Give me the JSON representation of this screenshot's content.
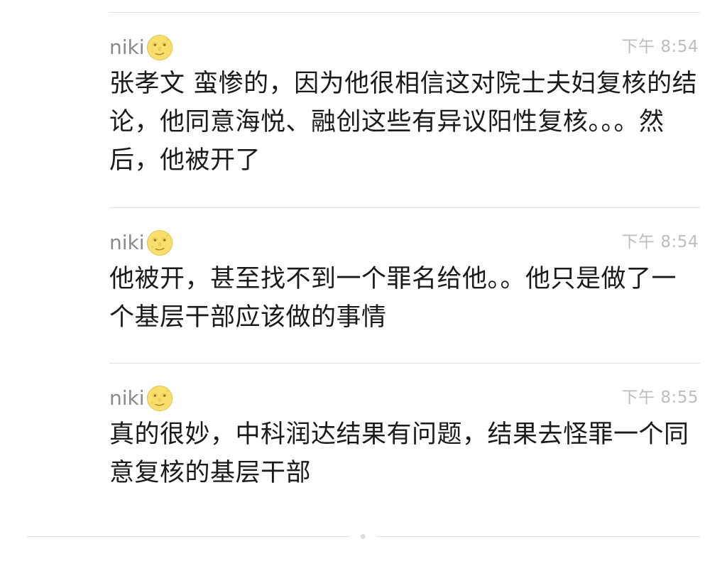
{
  "messages": [
    {
      "sender": "niki",
      "avatar_icon": "full-moon-face-emoji",
      "time": "下午 8:54",
      "text": "张孝文 蛮惨的，因为他很相信这对院士夫妇复核的结论，他同意海悦、融创这些有异议阳性复核。。。然后，他被开了"
    },
    {
      "sender": "niki",
      "avatar_icon": "full-moon-face-emoji",
      "time": "下午 8:54",
      "text": "他被开，甚至找不到一个罪名给他。。他只是做了一个基层干部应该做的事情"
    },
    {
      "sender": "niki",
      "avatar_icon": "full-moon-face-emoji",
      "time": "下午 8:55",
      "text": "真的很妙，中科润达结果有问题，结果去怪罪一个同意复核的基层干部"
    }
  ],
  "colors": {
    "background": "#ffffff",
    "name": "#8a8a8a",
    "time": "#bdbdbd",
    "text": "#1a1a1a",
    "divider": "#e2e2e2"
  }
}
